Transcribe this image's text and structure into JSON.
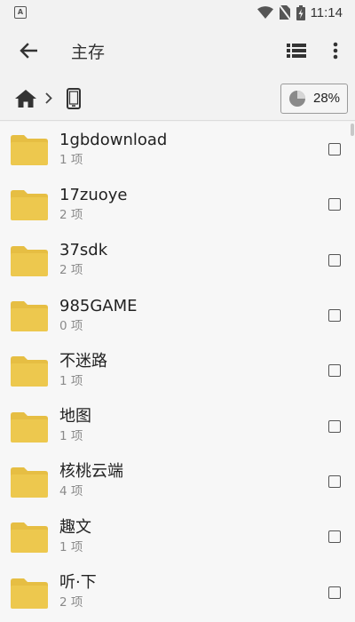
{
  "status_bar": {
    "notification_icon_letter": "A",
    "time": "11:14",
    "colors": {
      "icon": "#555555"
    }
  },
  "app_bar": {
    "title": "主存",
    "icons": [
      "back-arrow-icon",
      "list-view-icon",
      "more-vert-icon"
    ]
  },
  "path_bar": {
    "icons": [
      "home-icon",
      "chevron-right-icon",
      "phone-icon"
    ],
    "storage_usage_percent": 28,
    "storage_label": "28%"
  },
  "colors": {
    "folder": "#EDC84E",
    "folder_tab": "#E6BE43",
    "background": "#F2F2F2",
    "list_background": "#F7F7F7"
  },
  "files": [
    {
      "name": "1gbdownload",
      "count": "1 项"
    },
    {
      "name": "17zuoye",
      "count": "2 项"
    },
    {
      "name": "37sdk",
      "count": "2 项"
    },
    {
      "name": "985GAME",
      "count": "0 项"
    },
    {
      "name": "不迷路",
      "count": "1 项"
    },
    {
      "name": "地图",
      "count": "1 项"
    },
    {
      "name": "核桃云端",
      "count": "4 项"
    },
    {
      "name": "趣文",
      "count": "1 项"
    },
    {
      "name": "听·下",
      "count": "2 项"
    }
  ]
}
